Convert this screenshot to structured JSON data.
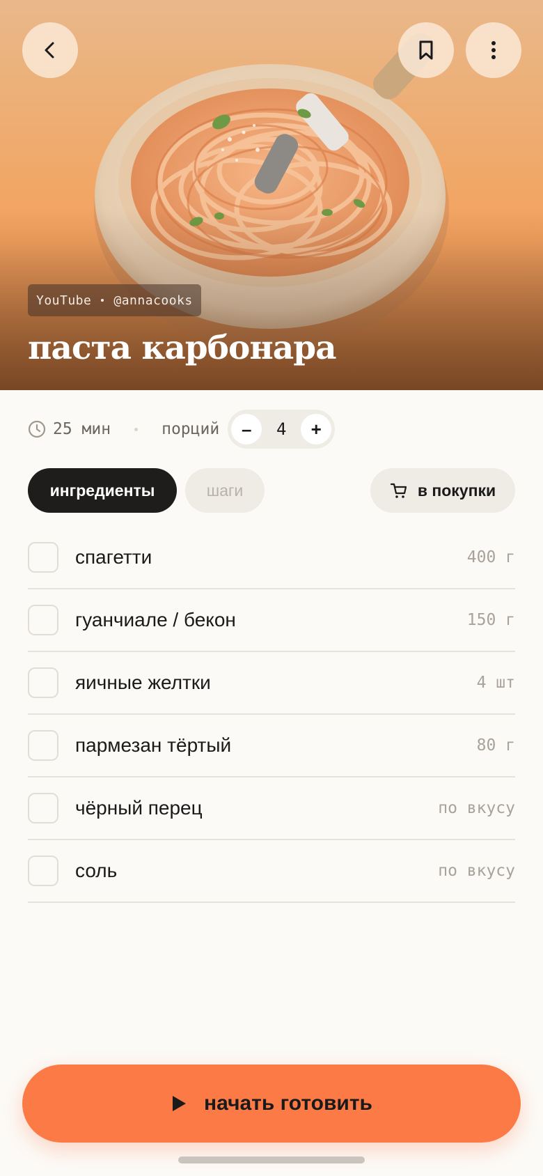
{
  "hero": {
    "source_platform": "YouTube",
    "source_author": "@annacooks",
    "title": "паста карбонара"
  },
  "meta": {
    "time": "25 мин",
    "servings_label": "порций",
    "servings": "4",
    "minus": "–",
    "plus": "+"
  },
  "tabs": {
    "ingredients": "ингредиенты",
    "steps": "шаги",
    "cart": "в покупки"
  },
  "ingredients": [
    {
      "name": "спагетти",
      "amount": "400 г"
    },
    {
      "name": "гуанчиале / бекон",
      "amount": "150 г"
    },
    {
      "name": "яичные желтки",
      "amount": "4 шт"
    },
    {
      "name": "пармезан тёртый",
      "amount": "80 г"
    },
    {
      "name": "чёрный перец",
      "amount": "по вкусу"
    },
    {
      "name": "соль",
      "amount": "по вкусу"
    }
  ],
  "cta": {
    "label": "начать готовить"
  },
  "colors": {
    "accent": "#fb7a46",
    "dark": "#1e1d1b",
    "muted": "#a8a29a"
  },
  "icons": [
    "back-icon",
    "bookmark-icon",
    "more-icon",
    "clock-icon",
    "cart-icon",
    "play-icon"
  ]
}
